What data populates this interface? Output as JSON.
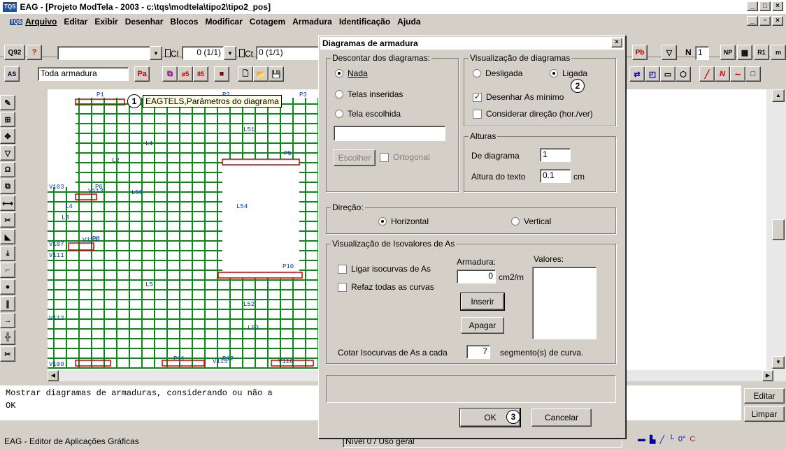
{
  "window": {
    "title": "EAG - [Projeto ModTela - 2003 - c:\\tqs\\modtela\\tipo2\\tipo2_pos]",
    "app_icon": "TQS"
  },
  "menu": [
    "Arquivo",
    "Editar",
    "Exibir",
    "Desenhar",
    "Blocos",
    "Modificar",
    "Cotagem",
    "Armadura",
    "Identificação",
    "Ajuda"
  ],
  "toolbar": {
    "q92": "Q92",
    "combo1_value": "",
    "cl_label": "Cl",
    "cl_value": "0 (1/1)",
    "ct_label": "Ct",
    "ct_value": "0 (1/1)",
    "n_label": "N",
    "n_value": "1",
    "layer_value": "Toda armadura",
    "pa_label": "Pa",
    "tooltip": "EAGTELS,Parâmetros do diagrama"
  },
  "plan_labels": [
    "P1",
    "P2",
    "P3",
    "P5",
    "P6",
    "P8",
    "P10",
    "P11",
    "P12",
    "L1",
    "L2",
    "L3",
    "L4",
    "L5",
    "L51",
    "L52",
    "L53",
    "L54",
    "L55",
    "V103",
    "V107",
    "V109",
    "V111",
    "V112",
    "V113",
    "V114",
    "V115",
    "V116"
  ],
  "command_area": {
    "line1": "Mostrar diagramas de armaduras, considerando ou não a",
    "line2": "OK"
  },
  "side_buttons": {
    "editar": "Editar",
    "limpar": "Limpar"
  },
  "status": {
    "left": "EAG - Editor de Aplicações Gráficas",
    "nivel": "Nível 0 / Uso geral"
  },
  "dialog": {
    "title": "Diagramas de armadura",
    "descontar": {
      "legend": "Descontar dos diagramas:",
      "options": [
        "Nada",
        "Telas inseridas",
        "Tela escolhida"
      ],
      "selected": "Nada",
      "choose_button": "Escolher",
      "ortogonal": "Ortogonal"
    },
    "visualizacao": {
      "legend": "Visualização de diagramas",
      "options": [
        "Desligada",
        "Ligada"
      ],
      "selected": "Ligada",
      "desenhar": "Desenhar As mínimo",
      "desenhar_checked": true,
      "considerar": "Considerar direção (hor./ver)",
      "considerar_checked": false
    },
    "alturas": {
      "legend": "Alturas",
      "diagrama_label": "De diagrama",
      "diagrama_value": "1",
      "texto_label": "Altura do texto",
      "texto_value": "0.1",
      "texto_unit": "cm"
    },
    "direcao": {
      "legend": "Direção:",
      "options": [
        "Horizontal",
        "Vertical"
      ],
      "selected": "Horizontal"
    },
    "isovalores": {
      "legend": "Visualização de Isovalores de As",
      "ligar": "Ligar isocurvas de As",
      "refaz": "Refaz todas as curvas",
      "armadura_label": "Armadura:",
      "armadura_value": "0",
      "armadura_unit": "cm2/m",
      "valores_label": "Valores:",
      "inserir": "Inserir",
      "apagar": "Apagar",
      "cotar_label": "Cotar Isocurvas de As a cada",
      "cotar_value": "7",
      "cotar_unit": "segmento(s) de curva."
    },
    "ok": "OK",
    "cancel": "Cancelar"
  },
  "markers": [
    "1",
    "2",
    "3"
  ]
}
